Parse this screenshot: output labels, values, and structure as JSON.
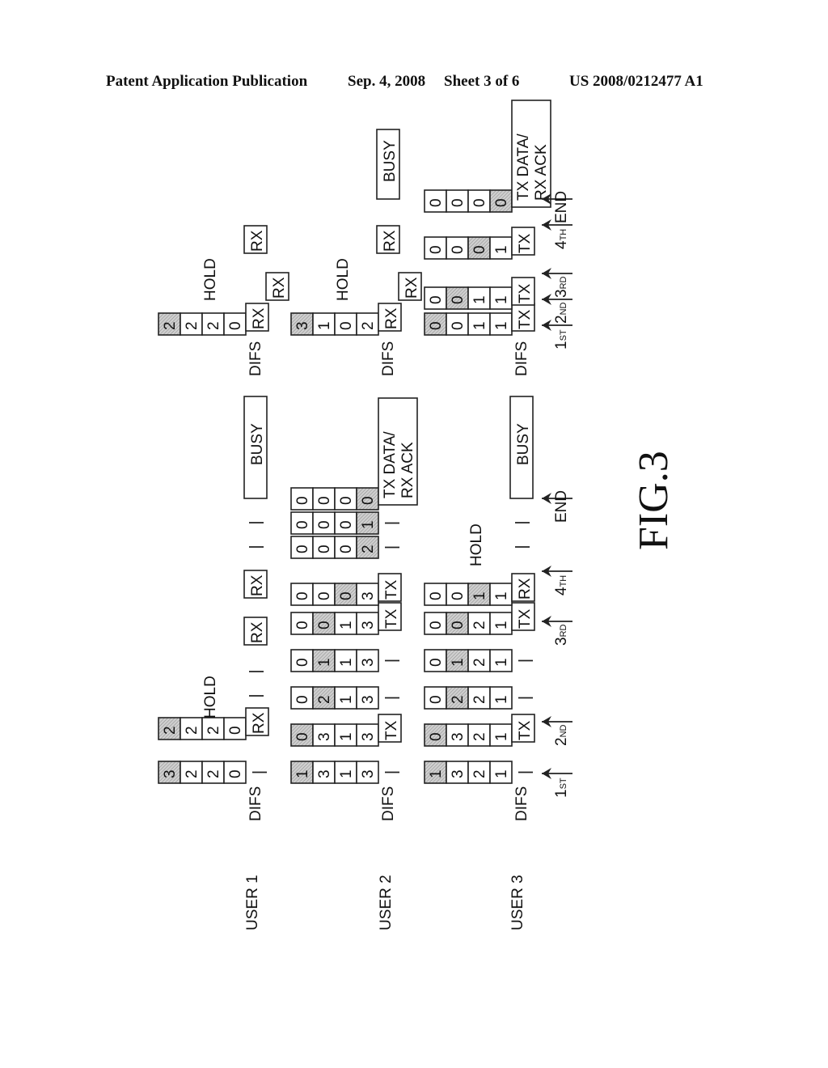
{
  "header": {
    "publication": "Patent Application Publication",
    "date": "Sep. 4, 2008",
    "sheet": "Sheet 3 of 6",
    "number": "US 2008/0212477 A1"
  },
  "figure": {
    "label": "FIG.3",
    "users": [
      {
        "label": "USER 1",
        "phase1": {
          "difs": "DIFS",
          "hold": "HOLD",
          "blocks": [
            {
              "values": [
                "3",
                "2",
                "2",
                "0"
              ],
              "shaded": [
                0
              ],
              "marker": "tick"
            },
            {
              "values": [
                "2",
                "2",
                "2",
                "0"
              ],
              "shaded": [
                0
              ],
              "marker": "RX"
            }
          ],
          "slots": [
            {
              "type": "tick"
            },
            {
              "type": "tick"
            },
            {
              "type": "box",
              "text": "RX"
            },
            {
              "type": "box",
              "text": "RX"
            },
            {
              "type": "tick"
            },
            {
              "type": "tick"
            },
            {
              "type": "busy",
              "text": "BUSY"
            }
          ]
        },
        "phase2": {
          "difs": "DIFS",
          "hold": "HOLD",
          "blocks": [
            {
              "values": [
                "2",
                "2",
                "2",
                "0"
              ],
              "shaded": [
                0
              ],
              "marker": "RX"
            }
          ],
          "slots": [
            {
              "type": "box",
              "text": "RX"
            },
            {
              "type": "box",
              "text": "RX"
            },
            {
              "type": "box",
              "text": "RX"
            }
          ]
        }
      },
      {
        "label": "USER 2",
        "phase1": {
          "difs": "DIFS",
          "blocks": [
            {
              "values": [
                "1",
                "3",
                "1",
                "3"
              ],
              "shaded": [
                0
              ],
              "marker": "tick"
            },
            {
              "values": [
                "0",
                "3",
                "1",
                "3"
              ],
              "shaded": [
                0
              ],
              "marker": "TX"
            },
            {
              "values": [
                "0",
                "2",
                "1",
                "3"
              ],
              "shaded": [
                1
              ],
              "marker": "tick"
            },
            {
              "values": [
                "0",
                "1",
                "1",
                "3"
              ],
              "shaded": [
                1
              ],
              "marker": "tick"
            },
            {
              "values": [
                "0",
                "0",
                "1",
                "3"
              ],
              "shaded": [
                1
              ],
              "marker": "TX"
            },
            {
              "values": [
                "0",
                "0",
                "0",
                "3"
              ],
              "shaded": [
                2
              ],
              "marker": "TX"
            },
            {
              "values": [
                "0",
                "0",
                "0",
                "2"
              ],
              "shaded": [
                3
              ],
              "marker": "tick"
            },
            {
              "values": [
                "0",
                "0",
                "0",
                "1"
              ],
              "shaded": [
                3
              ],
              "marker": "tick"
            },
            {
              "values": [
                "0",
                "0",
                "0",
                "0"
              ],
              "shaded": [
                3
              ],
              "marker": "TX DATA/ RX ACK"
            }
          ]
        },
        "phase2": {
          "difs": "DIFS",
          "hold": "HOLD",
          "blocks": [
            {
              "values": [
                "3",
                "1",
                "0",
                "2"
              ],
              "shaded": [
                0
              ],
              "marker": "RX"
            }
          ],
          "slots": [
            {
              "type": "box",
              "text": "RX"
            },
            {
              "type": "box",
              "text": "RX"
            },
            {
              "type": "box",
              "text": "RX"
            },
            {
              "type": "busy",
              "text": "BUSY"
            }
          ]
        }
      },
      {
        "label": "USER 3",
        "phase1": {
          "difs": "DIFS",
          "hold": "HOLD",
          "blocks": [
            {
              "values": [
                "1",
                "3",
                "2",
                "1"
              ],
              "shaded": [
                0
              ],
              "marker": "tick"
            },
            {
              "values": [
                "0",
                "3",
                "2",
                "1"
              ],
              "shaded": [
                0
              ],
              "marker": "TX"
            },
            {
              "values": [
                "0",
                "2",
                "2",
                "1"
              ],
              "shaded": [
                1
              ],
              "marker": "tick"
            },
            {
              "values": [
                "0",
                "1",
                "2",
                "1"
              ],
              "shaded": [
                1
              ],
              "marker": "tick"
            },
            {
              "values": [
                "0",
                "0",
                "2",
                "1"
              ],
              "shaded": [
                1
              ],
              "marker": "TX"
            },
            {
              "values": [
                "0",
                "0",
                "1",
                "1"
              ],
              "shaded": [
                2
              ],
              "marker": "RX"
            }
          ],
          "slots": [
            {
              "type": "tick"
            },
            {
              "type": "tick"
            },
            {
              "type": "busy",
              "text": "BUSY"
            }
          ]
        },
        "phase2": {
          "difs": "DIFS",
          "blocks": [
            {
              "values": [
                "0",
                "0",
                "1",
                "1"
              ],
              "shaded": [
                0
              ],
              "marker": "TX"
            },
            {
              "values": [
                "0",
                "0",
                "1",
                "1"
              ],
              "shaded": [
                1
              ],
              "marker": "TX"
            },
            {
              "values": [
                "0",
                "0",
                "0",
                "1"
              ],
              "shaded": [
                2
              ],
              "marker": "TX"
            },
            {
              "values": [
                "0",
                "0",
                "0",
                "0"
              ],
              "shaded": [
                3
              ],
              "marker": "TX DATA/ RX ACK"
            }
          ]
        }
      }
    ],
    "arrows_phase1": [
      {
        "main": "1",
        "sub": "ST"
      },
      {
        "main": "2",
        "sub": "ND"
      },
      {
        "main": "3",
        "sub": "RD"
      },
      {
        "main": "4",
        "sub": "TH"
      },
      {
        "main": "END",
        "sub": ""
      }
    ],
    "arrows_phase2": [
      {
        "main": "1",
        "sub": "ST"
      },
      {
        "main": "2",
        "sub": "ND"
      },
      {
        "main": "3",
        "sub": "RD"
      },
      {
        "main": "4",
        "sub": "TH"
      },
      {
        "main": "END",
        "sub": ""
      }
    ]
  }
}
